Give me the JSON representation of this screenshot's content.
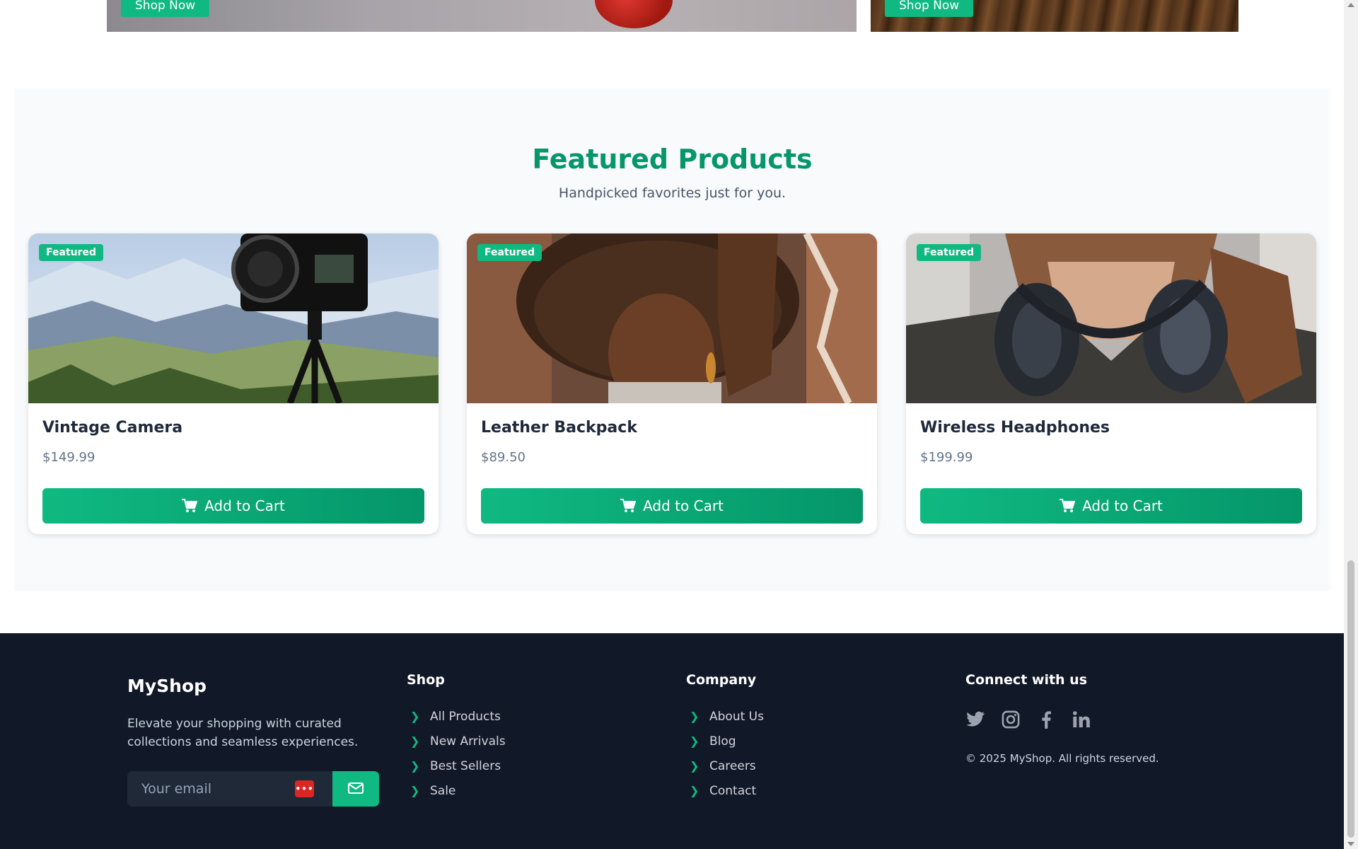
{
  "hero": {
    "left_button": "Shop Now",
    "right_button": "Shop Now"
  },
  "featured": {
    "title": "Featured Products",
    "subtitle": "Handpicked favorites just for you."
  },
  "products": [
    {
      "badge": "Featured",
      "name": "Vintage Camera",
      "price": "$149.99",
      "button": "Add to Cart"
    },
    {
      "badge": "Featured",
      "name": "Leather Backpack",
      "price": "$89.50",
      "button": "Add to Cart"
    },
    {
      "badge": "Featured",
      "name": "Wireless Headphones",
      "price": "$199.99",
      "button": "Add to Cart"
    }
  ],
  "footer": {
    "brand": "MyShop",
    "tagline": "Elevate your shopping with curated collections and seamless experiences.",
    "email_placeholder": "Your email",
    "shop": {
      "title": "Shop",
      "links": [
        "All Products",
        "New Arrivals",
        "Best Sellers",
        "Sale"
      ]
    },
    "company": {
      "title": "Company",
      "links": [
        "About Us",
        "Blog",
        "Careers",
        "Contact"
      ]
    },
    "connect": {
      "title": "Connect with us",
      "icons": [
        "twitter-icon",
        "instagram-icon",
        "facebook-icon",
        "linkedin-icon"
      ]
    },
    "copyright": "© 2025 MyShop. All rights reserved."
  },
  "colors": {
    "accent": "#10b981",
    "accent_dark": "#059669",
    "footer_bg": "#111827",
    "section_bg": "#f8fafc"
  }
}
